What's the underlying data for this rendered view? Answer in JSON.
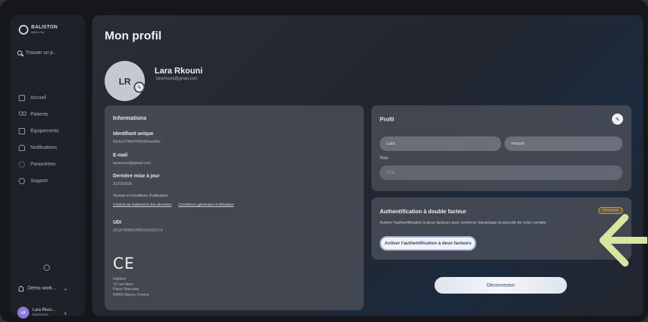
{
  "app": {
    "logo_text": "BALISTON",
    "logo_sub": "HEALTH",
    "search_placeholder": "Trouver un p..."
  },
  "sidebar": {
    "items": [
      {
        "label": "Accueil",
        "icon": "home-icon"
      },
      {
        "label": "Patients",
        "icon": "users-icon"
      },
      {
        "label": "Équipements",
        "icon": "equipment-icon"
      },
      {
        "label": "Notifications",
        "icon": "bell-icon"
      },
      {
        "label": "Paramètres",
        "icon": "gear-icon"
      },
      {
        "label": "Support",
        "icon": "help-icon"
      }
    ],
    "workspace": "Demo work...",
    "user": {
      "initials": "LR",
      "name": "Lara Rkou...",
      "email": "lararkouni..."
    }
  },
  "page": {
    "title": "Mon profil",
    "avatar_initials": "LR",
    "name": "Lara Rkouni",
    "email": "lararkouni@gmail.com"
  },
  "info": {
    "title": "Informations",
    "uid_label": "Identifiant unique",
    "uid_value": "69cbc2744cf7655466ae9lec",
    "email_label": "E-mail",
    "email_value": "lararkouni@gmail.com",
    "updated_label": "Dernière mise à jour",
    "updated_value": "31/03/2026",
    "terms_heading": "Termes et conditions d'utilisation",
    "link_contract": "Contrat de traitement des données",
    "link_cgu": "Conditions générales d'utilisation",
    "udi_label": "UDI",
    "udi_value": "(01)3700565780010(10)3.3.5",
    "ce_mark": "CE",
    "address_lines": [
      "Digitsol",
      "13 rue Here",
      "Place Stanislas",
      "54000 Nancy, France"
    ]
  },
  "profil": {
    "title": "Profil",
    "first_name": "Lara",
    "last_name": "Rkouni",
    "role_label": "Rôle",
    "role_placeholder": "Rôle"
  },
  "twofa": {
    "title": "Authentification à double facteur",
    "status": "Désactivé",
    "description": "Activer l'authentification à deux facteurs pour renforcer davantage la sécurité de votre compte.",
    "button": "Activer l'authentification à deux facteurs"
  },
  "logout": "Déconnexion",
  "colors": {
    "accent": "#2c3e66",
    "warning": "#d6a02b",
    "arrow": "#d8e6a0"
  }
}
